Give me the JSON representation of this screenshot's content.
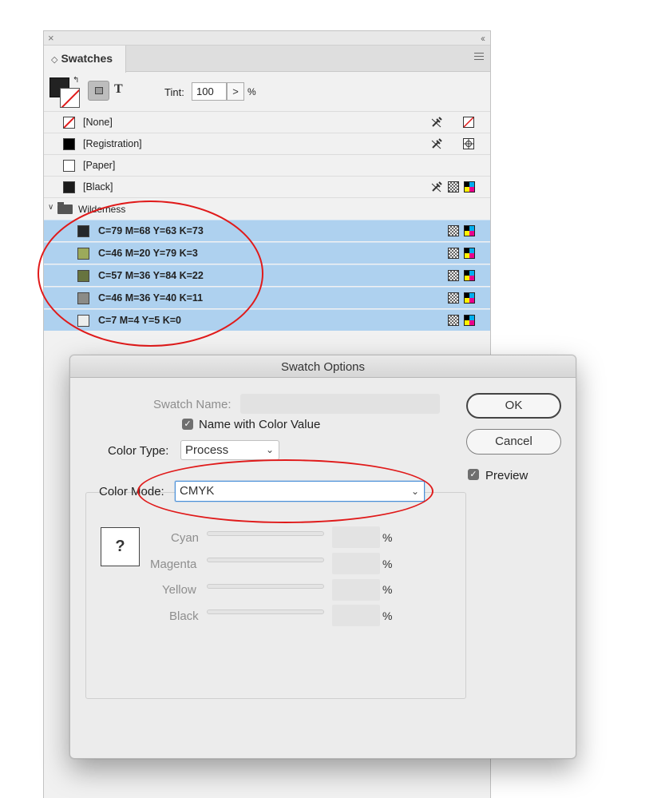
{
  "panel": {
    "close_glyph": "×",
    "collapse_glyph": "‹‹",
    "tab_label": "Swatches",
    "tint_label": "Tint:",
    "tint_value": "100",
    "tint_arrow": ">",
    "tint_unit": "%",
    "apply_text_glyph": "T",
    "swatches": [
      {
        "name": "[None]",
        "color": "none",
        "icons": [
          "no-edit-icon",
          "none-icon"
        ]
      },
      {
        "name": "[Registration]",
        "color": "#000000",
        "icons": [
          "no-edit-icon",
          "registration-icon"
        ]
      },
      {
        "name": "[Paper]",
        "color": "#ffffff",
        "icons": []
      },
      {
        "name": "[Black]",
        "color": "#1a1a1a",
        "icons": [
          "no-edit-icon",
          "process-icon",
          "cmyk-icon"
        ]
      }
    ],
    "group": {
      "name": "Wilderness",
      "items": [
        {
          "name": "C=79 M=68 Y=63 K=73",
          "color": "#25272a"
        },
        {
          "name": "C=46 M=20 Y=79 K=3",
          "color": "#9caa5b"
        },
        {
          "name": "C=57 M=36 Y=84 K=22",
          "color": "#67743f"
        },
        {
          "name": "C=46 M=36 Y=40 K=11",
          "color": "#8b8b87"
        },
        {
          "name": "C=7 M=4 Y=5 K=0",
          "color": "#eceeed"
        }
      ]
    }
  },
  "dialog": {
    "title": "Swatch Options",
    "swatch_name_label": "Swatch Name:",
    "swatch_name_value": "",
    "name_with_value_label": "Name with Color Value",
    "name_with_value_checked": true,
    "color_type_label": "Color Type:",
    "color_type_value": "Process",
    "color_mode_label": "Color Mode:",
    "color_mode_value": "CMYK",
    "preview_symbol": "?",
    "channels": [
      {
        "label": "Cyan",
        "value": "",
        "unit": "%"
      },
      {
        "label": "Magenta",
        "value": "",
        "unit": "%"
      },
      {
        "label": "Yellow",
        "value": "",
        "unit": "%"
      },
      {
        "label": "Black",
        "value": "",
        "unit": "%"
      }
    ],
    "ok_label": "OK",
    "cancel_label": "Cancel",
    "preview_label": "Preview",
    "preview_checked": true,
    "checkmark": "✓",
    "chevron": "⌄"
  },
  "colors": {
    "selection": "#aed1ef",
    "annotation": "#e01a1a",
    "focus_ring": "#4a90d9"
  }
}
